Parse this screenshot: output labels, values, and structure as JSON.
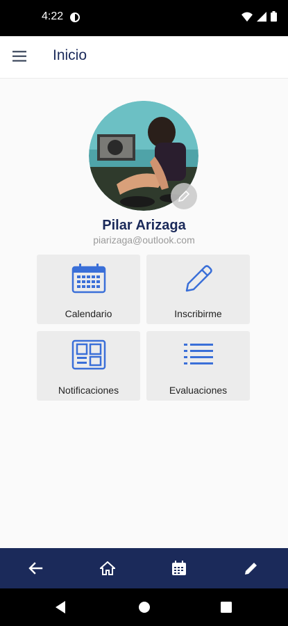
{
  "status_bar": {
    "time": "4:22"
  },
  "app_bar": {
    "title": "Inicio"
  },
  "profile": {
    "name": "Pilar Arizaga",
    "email": "piarizaga@outlook.com"
  },
  "menu_cards": [
    {
      "label": "Calendario",
      "icon": "calendar-icon"
    },
    {
      "label": "Inscribirme",
      "icon": "pencil-icon"
    },
    {
      "label": "Notificaciones",
      "icon": "dashboard-icon"
    },
    {
      "label": "Evaluaciones",
      "icon": "list-icon"
    }
  ],
  "bottom_nav": [
    "back-arrow-icon",
    "home-icon",
    "calendar-icon",
    "edit-icon"
  ],
  "colors": {
    "primary": "#1b2a5a",
    "accent": "#3a6fd8",
    "card": "#ececec"
  }
}
